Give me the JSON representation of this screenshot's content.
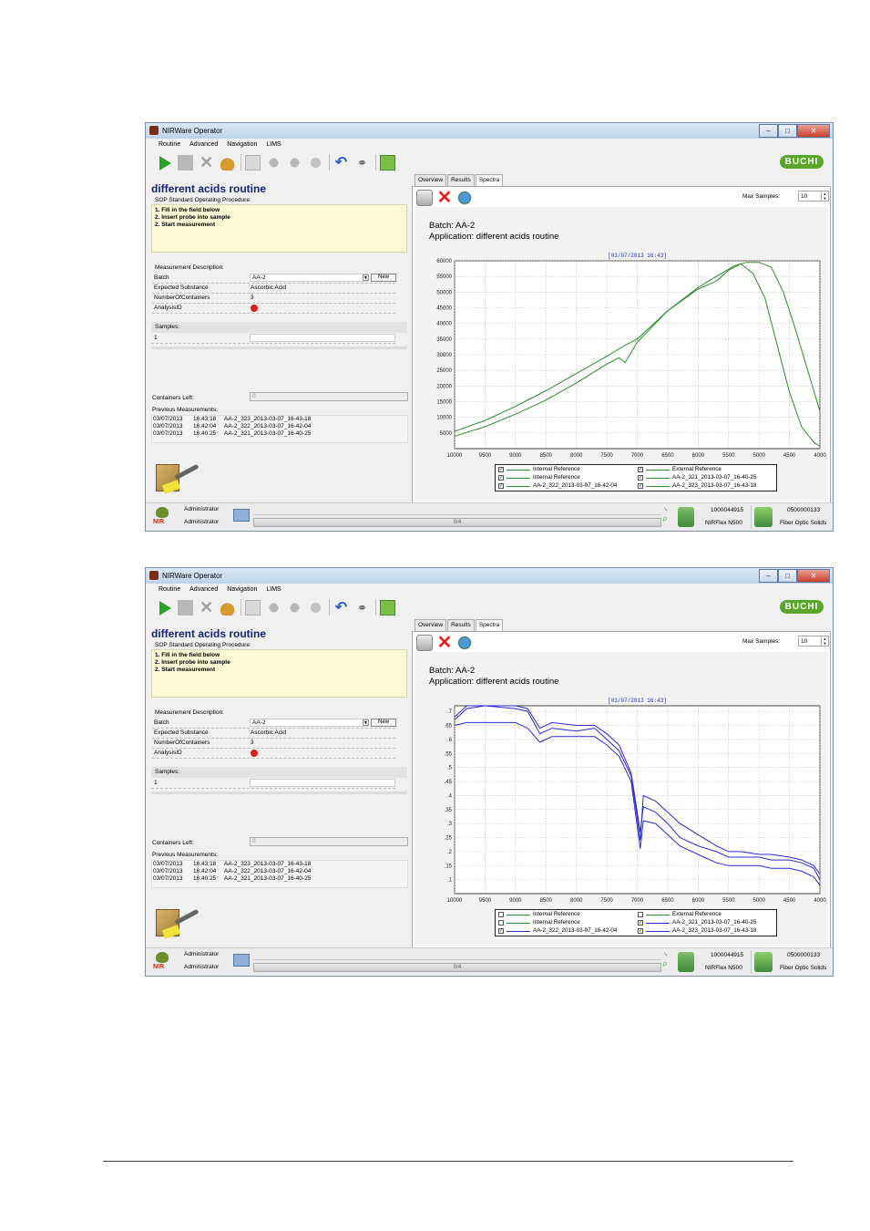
{
  "screens": [
    {
      "window_title": "NIRWare Operator",
      "menu": [
        "Routine",
        "Advanced",
        "Navigation",
        "LIMS"
      ],
      "brand": "BUCHI",
      "routine_title": "different acids routine",
      "sop_label": "SOP Standard Operating Procedure:",
      "sop_lines": [
        "1. Fill in the field below",
        "2. Insert probe into sample",
        "2. Start measurement"
      ],
      "measurement_description_label": "Measurement Description:",
      "fields": [
        {
          "key": "Batch",
          "value": "AA-2"
        },
        {
          "key": "Expected Substance",
          "value": "Ascorbic Acid"
        },
        {
          "key": "NumberOfContainers",
          "value": "3"
        },
        {
          "key": "AnalysisID",
          "value": ""
        }
      ],
      "new_button": "New",
      "samples_label": "Samples:",
      "samples_value": "1",
      "containers_left_label": "Containers Left:",
      "containers_left_value": "0",
      "previous_measurements_label": "Previous Measurements:",
      "previous_measurements": [
        {
          "date": "03/07/2013",
          "time": "16:43:18",
          "name": "AA-2_323_2013-03-07_16-43-18"
        },
        {
          "date": "03/07/2013",
          "time": "16:42:04",
          "name": "AA-2_322_2013-03-07_16-42-04"
        },
        {
          "date": "03/07/2013",
          "time": "16:40:25",
          "name": "AA-2_321_2013-03-07_16-40-25"
        }
      ],
      "tabs": [
        "Overview",
        "Results",
        "Spectra"
      ],
      "active_tab": "Spectra",
      "max_samples_label": "Max Samples:",
      "max_samples_value": "10",
      "batch_line": "Batch: AA-2",
      "application_line": "Application: different acids routine",
      "status": {
        "user_top": "Administrator",
        "user_bottom": "Administrator",
        "progress_text": "0/4",
        "instrument_sn": "1000044915",
        "instrument_name": "NIRFlex N500",
        "accessory_sn": "0500000133",
        "accessory_name": "Fiber Optic Solids"
      },
      "legend": [
        {
          "label": "Internal Reference",
          "checked": true,
          "color": "#2e8b2e"
        },
        {
          "label": "External Reference",
          "checked": true,
          "color": "#2e8b2e"
        },
        {
          "label": "Internal Reference",
          "checked": true,
          "color": "#2e8b2e"
        },
        {
          "label": "AA-2_321_2013-03-07_16-40-25",
          "checked": true,
          "color": "#2e8b2e"
        },
        {
          "label": "AA-2_322_2013-03-07_16-42-04",
          "checked": true,
          "color": "#2e8b2e"
        },
        {
          "label": "AA-2_323_2013-03-07_16-43-18",
          "checked": true,
          "color": "#2e8b2e"
        }
      ],
      "chart_data": {
        "type": "line",
        "title": "[03/07/2013 16:43]",
        "xlabel": "",
        "ylabel": "",
        "x_reversed": true,
        "xlim": [
          10000,
          4000
        ],
        "ylim": [
          0,
          60000
        ],
        "xticks": [
          10000,
          9500,
          9000,
          8500,
          8000,
          7500,
          7000,
          6500,
          6000,
          5500,
          5000,
          4500,
          4000
        ],
        "yticks": [
          5000,
          10000,
          15000,
          20000,
          25000,
          30000,
          35000,
          40000,
          45000,
          50000,
          55000,
          60000
        ],
        "ytick_labels": [
          "5000",
          "10000",
          "15000",
          "20000",
          "25000",
          "30000",
          "35000",
          "40000",
          "45000",
          "50000",
          "55000",
          "60000"
        ],
        "grid": true,
        "series": [
          {
            "name": "Internal Reference",
            "color": "#2e8b2e",
            "x": [
              10000,
              9500,
              9000,
              8500,
              8000,
              7500,
              7300,
              7200,
              7000,
              6500,
              6000,
              5700,
              5500,
              5300,
              5100,
              4900,
              4700,
              4500,
              4300,
              4100,
              4000
            ],
            "y": [
              4000,
              7000,
              11000,
              15500,
              21000,
              27000,
              29000,
              27500,
              34000,
              44000,
              51000,
              53500,
              57000,
              59000,
              56000,
              48000,
              33000,
              18000,
              7000,
              2000,
              800
            ]
          },
          {
            "name": "External Reference",
            "color": "#2e8b2e",
            "x": [
              10000,
              9500,
              9000,
              8500,
              8000,
              7500,
              7200,
              7000,
              6500,
              6000,
              5700,
              5400,
              5200,
              5000,
              4800,
              4600,
              4400,
              4200,
              4000
            ],
            "y": [
              5500,
              9000,
              13500,
              18500,
              24000,
              29500,
              33000,
              35000,
              44000,
              51500,
              55000,
              58500,
              59500,
              59500,
              58000,
              50000,
              38000,
              25000,
              12000
            ]
          }
        ]
      }
    },
    {
      "window_title": "NIRWare Operator",
      "menu": [
        "Routine",
        "Advanced",
        "Navigation",
        "LIMS"
      ],
      "brand": "BUCHI",
      "routine_title": "different acids routine",
      "sop_label": "SOP Standard Operating Procedure:",
      "sop_lines": [
        "1. Fill in the field below",
        "2. Insert probe into sample",
        "2. Start measurement"
      ],
      "measurement_description_label": "Measurement Description:",
      "fields": [
        {
          "key": "Batch",
          "value": "AA-2"
        },
        {
          "key": "Expected Substance",
          "value": "Ascorbic Acid"
        },
        {
          "key": "NumberOfContainers",
          "value": "3"
        },
        {
          "key": "AnalysisID",
          "value": ""
        }
      ],
      "new_button": "New",
      "samples_label": "Samples:",
      "samples_value": "1",
      "containers_left_label": "Containers Left:",
      "containers_left_value": "0",
      "previous_measurements_label": "Previous Measurements:",
      "previous_measurements": [
        {
          "date": "03/07/2013",
          "time": "16:43:18",
          "name": "AA-2_323_2013-03-07_16-43-18"
        },
        {
          "date": "03/07/2013",
          "time": "16:42:04",
          "name": "AA-2_322_2013-03-07_16-42-04"
        },
        {
          "date": "03/07/2013",
          "time": "16:40:25",
          "name": "AA-2_321_2013-03-07_16-40-25"
        }
      ],
      "tabs": [
        "Overview",
        "Results",
        "Spectra"
      ],
      "active_tab": "Spectra",
      "max_samples_label": "Max Samples:",
      "max_samples_value": "10",
      "batch_line": "Batch: AA-2",
      "application_line": "Application: different acids routine",
      "status": {
        "user_top": "Administrator",
        "user_bottom": "Administrator",
        "progress_text": "0/4",
        "instrument_sn": "1000044915",
        "instrument_name": "NIRFlex N500",
        "accessory_sn": "0500000133",
        "accessory_name": "Fiber Optic Solids"
      },
      "legend": [
        {
          "label": "Internal Reference",
          "checked": false,
          "color": "#2e8b2e"
        },
        {
          "label": "External Reference",
          "checked": false,
          "color": "#2e8b2e"
        },
        {
          "label": "Internal Reference",
          "checked": false,
          "color": "#2e8b2e"
        },
        {
          "label": "AA-2_321_2013-03-07_16-40-25",
          "checked": true,
          "color": "#2a2ad0"
        },
        {
          "label": "AA-2_322_2013-03-07_16-42-04",
          "checked": true,
          "color": "#2a2ad0"
        },
        {
          "label": "AA-2_323_2013-03-07_16-43-18",
          "checked": true,
          "color": "#2a2ad0"
        }
      ],
      "chart_data": {
        "type": "line",
        "title": "[03/07/2013 16:43]",
        "xlabel": "",
        "ylabel": "",
        "x_reversed": true,
        "xlim": [
          10000,
          4000
        ],
        "ylim": [
          0.05,
          0.72
        ],
        "xticks": [
          10000,
          9500,
          9000,
          8500,
          8000,
          7500,
          7000,
          6500,
          6000,
          5500,
          5000,
          4500,
          4000
        ],
        "yticks": [
          0.1,
          0.15,
          0.2,
          0.25,
          0.3,
          0.35,
          0.4,
          0.45,
          0.5,
          0.55,
          0.6,
          0.65,
          0.7
        ],
        "ytick_labels": [
          ".1",
          ".15",
          ".2",
          ".25",
          ".3",
          ".35",
          ".4",
          ".45",
          ".5",
          ".55",
          ".6",
          ".65",
          ".7"
        ],
        "grid": true,
        "series": [
          {
            "name": "AA-2_321_2013-03-07_16-40-25",
            "color": "#2a2ad0",
            "x": [
              10000,
              9800,
              9500,
              9000,
              8800,
              8600,
              8400,
              8000,
              7700,
              7500,
              7300,
              7100,
              7000,
              6950,
              6900,
              6700,
              6500,
              6300,
              6000,
              5700,
              5500,
              5300,
              5000,
              4800,
              4500,
              4300,
              4100,
              4000
            ],
            "y": [
              0.67,
              0.71,
              0.72,
              0.72,
              0.71,
              0.64,
              0.66,
              0.65,
              0.65,
              0.62,
              0.58,
              0.48,
              0.34,
              0.27,
              0.36,
              0.34,
              0.3,
              0.25,
              0.22,
              0.2,
              0.18,
              0.18,
              0.18,
              0.17,
              0.17,
              0.16,
              0.14,
              0.1
            ]
          },
          {
            "name": "AA-2_322_2013-03-07_16-42-04",
            "color": "#2a2ad0",
            "x": [
              10000,
              9800,
              9500,
              9000,
              8800,
              8600,
              8400,
              8000,
              7700,
              7500,
              7300,
              7100,
              7000,
              6950,
              6900,
              6700,
              6500,
              6300,
              6000,
              5700,
              5500,
              5300,
              5000,
              4800,
              4500,
              4300,
              4100,
              4000
            ],
            "y": [
              0.65,
              0.66,
              0.66,
              0.66,
              0.64,
              0.59,
              0.61,
              0.61,
              0.61,
              0.58,
              0.54,
              0.45,
              0.29,
              0.21,
              0.31,
              0.3,
              0.26,
              0.22,
              0.19,
              0.16,
              0.15,
              0.15,
              0.15,
              0.14,
              0.14,
              0.13,
              0.11,
              0.08
            ]
          },
          {
            "name": "AA-2_323_2013-03-07_16-43-18",
            "color": "#2a2ad0",
            "x": [
              10000,
              9800,
              9500,
              9000,
              8800,
              8600,
              8400,
              8000,
              7700,
              7500,
              7300,
              7100,
              7000,
              6950,
              6900,
              6700,
              6500,
              6300,
              6000,
              5700,
              5500,
              5300,
              5000,
              4800,
              4500,
              4300,
              4100,
              4000
            ],
            "y": [
              0.68,
              0.72,
              0.72,
              0.71,
              0.7,
              0.62,
              0.64,
              0.63,
              0.64,
              0.6,
              0.56,
              0.47,
              0.32,
              0.24,
              0.4,
              0.38,
              0.34,
              0.3,
              0.26,
              0.22,
              0.2,
              0.2,
              0.19,
              0.19,
              0.18,
              0.17,
              0.15,
              0.12
            ]
          }
        ]
      }
    }
  ]
}
